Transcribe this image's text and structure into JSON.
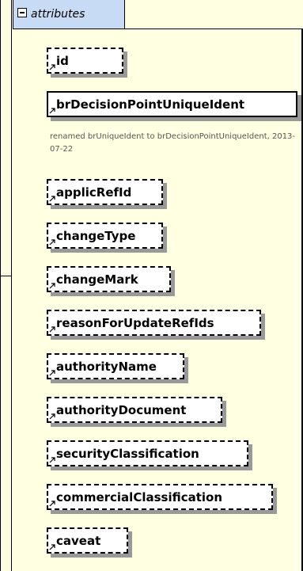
{
  "group": {
    "label": "attributes",
    "collapse_icon": "minus-box-icon"
  },
  "attributes": [
    {
      "name": "id",
      "required": false
    },
    {
      "name": "brDecisionPointUniqueIdent",
      "required": true,
      "note": "renamed brUniqueIdent to brDecisionPointUniqueIdent, 2013-07-22"
    },
    {
      "name": "applicRefId",
      "required": false
    },
    {
      "name": "changeType",
      "required": false
    },
    {
      "name": "changeMark",
      "required": false
    },
    {
      "name": "reasonForUpdateRefIds",
      "required": false
    },
    {
      "name": "authorityName",
      "required": false
    },
    {
      "name": "authorityDocument",
      "required": false
    },
    {
      "name": "securityClassification",
      "required": false
    },
    {
      "name": "commercialClassification",
      "required": false
    },
    {
      "name": "caveat",
      "required": false
    }
  ],
  "colors": {
    "background": "#ffffe1",
    "header": "#c7dcf4",
    "box": "#ffffff",
    "shadow": "#999999",
    "note_text": "#555555"
  },
  "icons": {
    "attribute_marker": "attribute-arrow-icon"
  }
}
